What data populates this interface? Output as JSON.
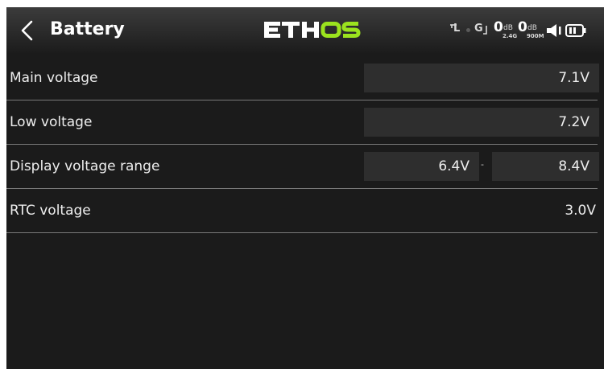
{
  "header": {
    "title": "Battery",
    "logo_text": "ETHOS",
    "status": {
      "rx_label": "L",
      "g_label": "G",
      "rssi_24": "0",
      "rssi_24_unit": "dB",
      "rssi_24_band": "2.4G",
      "rssi_900": "0",
      "rssi_900_unit": "dB",
      "rssi_900_band": "900M"
    }
  },
  "settings": {
    "main_voltage": {
      "label": "Main voltage",
      "value": "7.1V"
    },
    "low_voltage": {
      "label": "Low voltage",
      "value": "7.2V"
    },
    "display_range": {
      "label": "Display voltage range",
      "min": "6.4V",
      "separator": "-",
      "max": "8.4V"
    },
    "rtc_voltage": {
      "label": "RTC voltage",
      "value": "3.0V"
    }
  },
  "colors": {
    "accent": "#9be31e",
    "background": "#1b1b1b",
    "field": "#2e2e2e"
  }
}
